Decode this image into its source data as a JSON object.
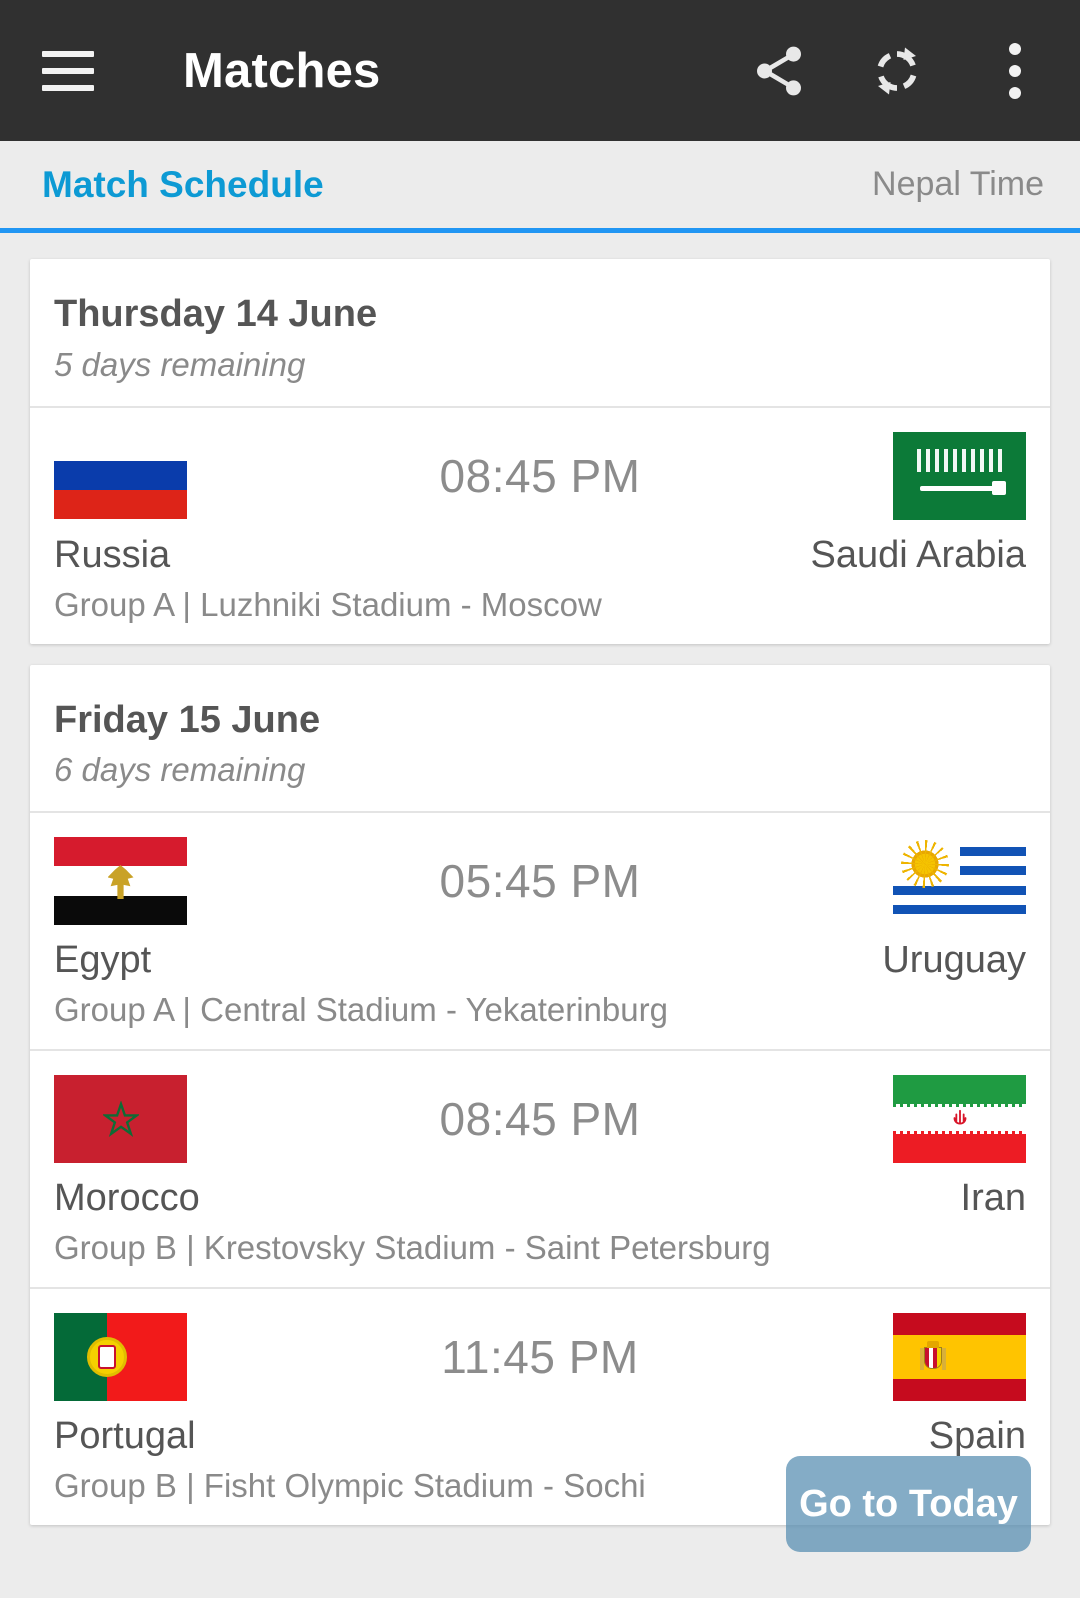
{
  "appbar": {
    "title": "Matches",
    "menu_icon": "hamburger-menu-icon",
    "share_icon": "share-icon",
    "refresh_icon": "refresh-icon",
    "overflow_icon": "more-vertical-icon"
  },
  "tabbar": {
    "active_tab": "Match Schedule",
    "timezone_label": "Nepal Time",
    "accent_color": "#0d9ad4",
    "underline_color": "#2196f3"
  },
  "fab": {
    "label": "Go to Today",
    "color": "#548cb0"
  },
  "days": [
    {
      "date_label": "Thursday 14 June",
      "remaining_label": "5 days remaining",
      "matches": [
        {
          "time": "08:45 PM",
          "home": {
            "name": "Russia",
            "flag": "flag-russia"
          },
          "away": {
            "name": "Saudi Arabia",
            "flag": "flag-saudi-arabia"
          },
          "meta": "Group A | Luzhniki Stadium - Moscow"
        }
      ]
    },
    {
      "date_label": "Friday 15 June",
      "remaining_label": "6 days remaining",
      "matches": [
        {
          "time": "05:45 PM",
          "home": {
            "name": "Egypt",
            "flag": "flag-egypt"
          },
          "away": {
            "name": "Uruguay",
            "flag": "flag-uruguay"
          },
          "meta": "Group A | Central Stadium - Yekaterinburg"
        },
        {
          "time": "08:45 PM",
          "home": {
            "name": "Morocco",
            "flag": "flag-morocco"
          },
          "away": {
            "name": "Iran",
            "flag": "flag-iran"
          },
          "meta": "Group B | Krestovsky Stadium - Saint Petersburg"
        },
        {
          "time": "11:45 PM",
          "home": {
            "name": "Portugal",
            "flag": "flag-portugal"
          },
          "away": {
            "name": "Spain",
            "flag": "flag-spain"
          },
          "meta": "Group B | Fisht Olympic Stadium - Sochi"
        }
      ]
    }
  ]
}
